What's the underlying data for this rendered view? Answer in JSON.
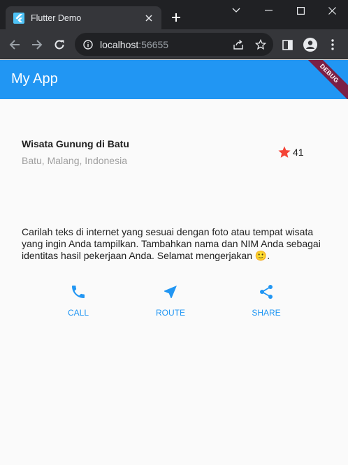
{
  "browser": {
    "tab_title": "Flutter Demo",
    "url_host": "localhost",
    "url_port": ":56655"
  },
  "app": {
    "title": "My App",
    "debug_banner": "DEBUG",
    "accent": "#2196f3"
  },
  "place": {
    "title": "Wisata Gunung di Batu",
    "location": "Batu, Malang, Indonesia",
    "rating_count": "41",
    "star_color": "#f44336"
  },
  "description": "Carilah teks di internet yang sesuai dengan foto atau tempat wisata yang ingin Anda tampilkan. Tambahkan nama dan NIM Anda sebagai identitas hasil pekerjaan Anda. Selamat mengerjakan 🙂.",
  "actions": [
    {
      "label": "CALL",
      "icon": "phone-icon"
    },
    {
      "label": "ROUTE",
      "icon": "navigation-icon"
    },
    {
      "label": "SHARE",
      "icon": "share-icon"
    }
  ]
}
